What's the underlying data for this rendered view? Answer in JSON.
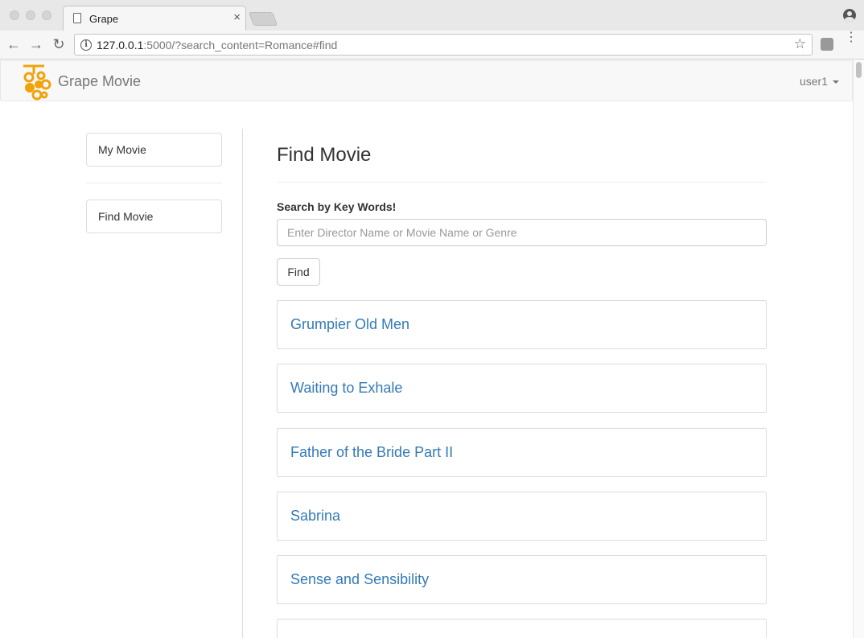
{
  "browser": {
    "tab_title": "Grape",
    "tab_close": "×",
    "url_host": "127.0.0.1",
    "url_rest": ":5000/?search_content=Romance#find",
    "back_icon": "←",
    "forward_icon": "→",
    "reload_icon": "↻",
    "star_icon": "☆",
    "menu_icon": "⋮"
  },
  "navbar": {
    "brand": "Grape Movie",
    "user": "user1",
    "logo_color": "#f0a30a"
  },
  "sidebar": {
    "items": [
      {
        "label": "My Movie"
      },
      {
        "label": "Find Movie"
      }
    ]
  },
  "main": {
    "title": "Find Movie",
    "search_label": "Search by Key Words!",
    "search_placeholder": "Enter Director Name or Movie Name or Genre",
    "search_value": "",
    "find_label": "Find",
    "results": [
      "Grumpier Old Men",
      "Waiting to Exhale",
      "Father of the Bride Part II",
      "Sabrina",
      "Sense and Sensibility"
    ]
  },
  "colors": {
    "link": "#337ab7",
    "brand_accent": "#f0a30a"
  }
}
